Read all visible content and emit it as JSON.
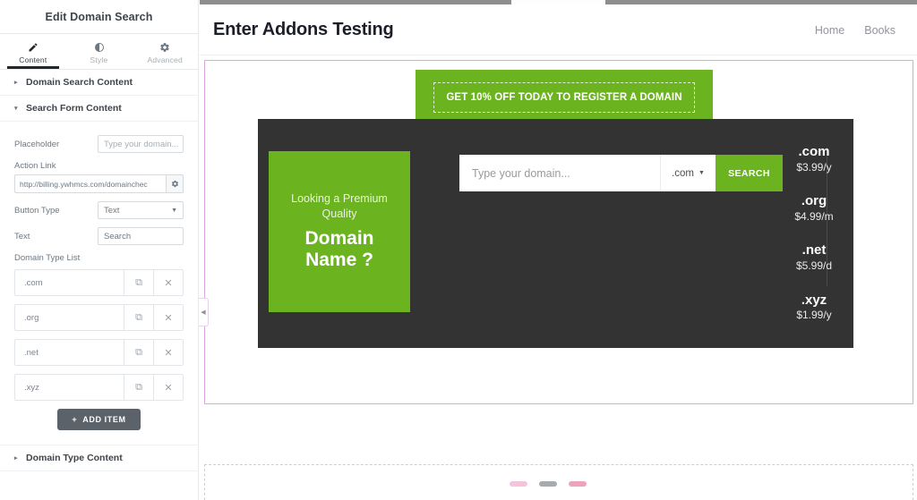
{
  "panel": {
    "title": "Edit Domain Search",
    "tabs": [
      {
        "label": "Content",
        "icon": "pencil-icon",
        "active": true
      },
      {
        "label": "Style",
        "icon": "contrast-icon",
        "active": false
      },
      {
        "label": "Advanced",
        "icon": "gear-icon",
        "active": false
      }
    ],
    "sections": [
      {
        "label": "Domain Search Content",
        "state": "collapsed",
        "caret": "▸"
      },
      {
        "label": "Search Form Content",
        "state": "expanded",
        "caret": "▾"
      },
      {
        "label": "Domain Type Content",
        "state": "collapsed",
        "caret": "▸"
      }
    ],
    "controls": {
      "placeholder_label": "Placeholder",
      "placeholder_value": "Type your domain...",
      "action_link_label": "Action Link",
      "action_link_value": "http://billing.ywhmcs.com/domainchec",
      "action_link_settings_icon": "gear-icon",
      "button_type_label": "Button Type",
      "button_type_value": "Text",
      "text_label": "Text",
      "text_value": "Search",
      "domain_type_list_label": "Domain Type List"
    },
    "repeater_items": [
      {
        "title": ".com"
      },
      {
        "title": ".org"
      },
      {
        "title": ".net"
      },
      {
        "title": ".xyz"
      }
    ],
    "repeater_tools": {
      "duplicate_icon": "⧉",
      "remove_icon": "✕"
    },
    "add_item_label": "ADD ITEM",
    "add_item_icon": "+",
    "collapse_handle_icon": "◀"
  },
  "site": {
    "title": "Enter Addons Testing",
    "nav": [
      {
        "label": "Home"
      },
      {
        "label": "Books"
      }
    ]
  },
  "widget": {
    "promo_banner": "GET 10% OFF TODAY TO REGISTER A DOMAIN",
    "left_promo": {
      "small_text": "Looking a Premium Quality",
      "big_text": "Domain Name ?"
    },
    "search": {
      "input_placeholder": "Type your domain...",
      "tld_selected": ".com",
      "tld_caret_icon": "chevron-down-icon",
      "button_label": "SEARCH"
    },
    "prices": [
      {
        "tld": ".com",
        "amount": "$3.99/y"
      },
      {
        "tld": ".org",
        "amount": "$4.99/m"
      },
      {
        "tld": ".net",
        "amount": "$5.99/d"
      },
      {
        "tld": ".xyz",
        "amount": "$1.99/y"
      }
    ]
  },
  "colors": {
    "green": "#6cb41f",
    "dark": "#333333",
    "selection_outline": "#dda6e3",
    "panel_dark_button": "#5b6269"
  }
}
